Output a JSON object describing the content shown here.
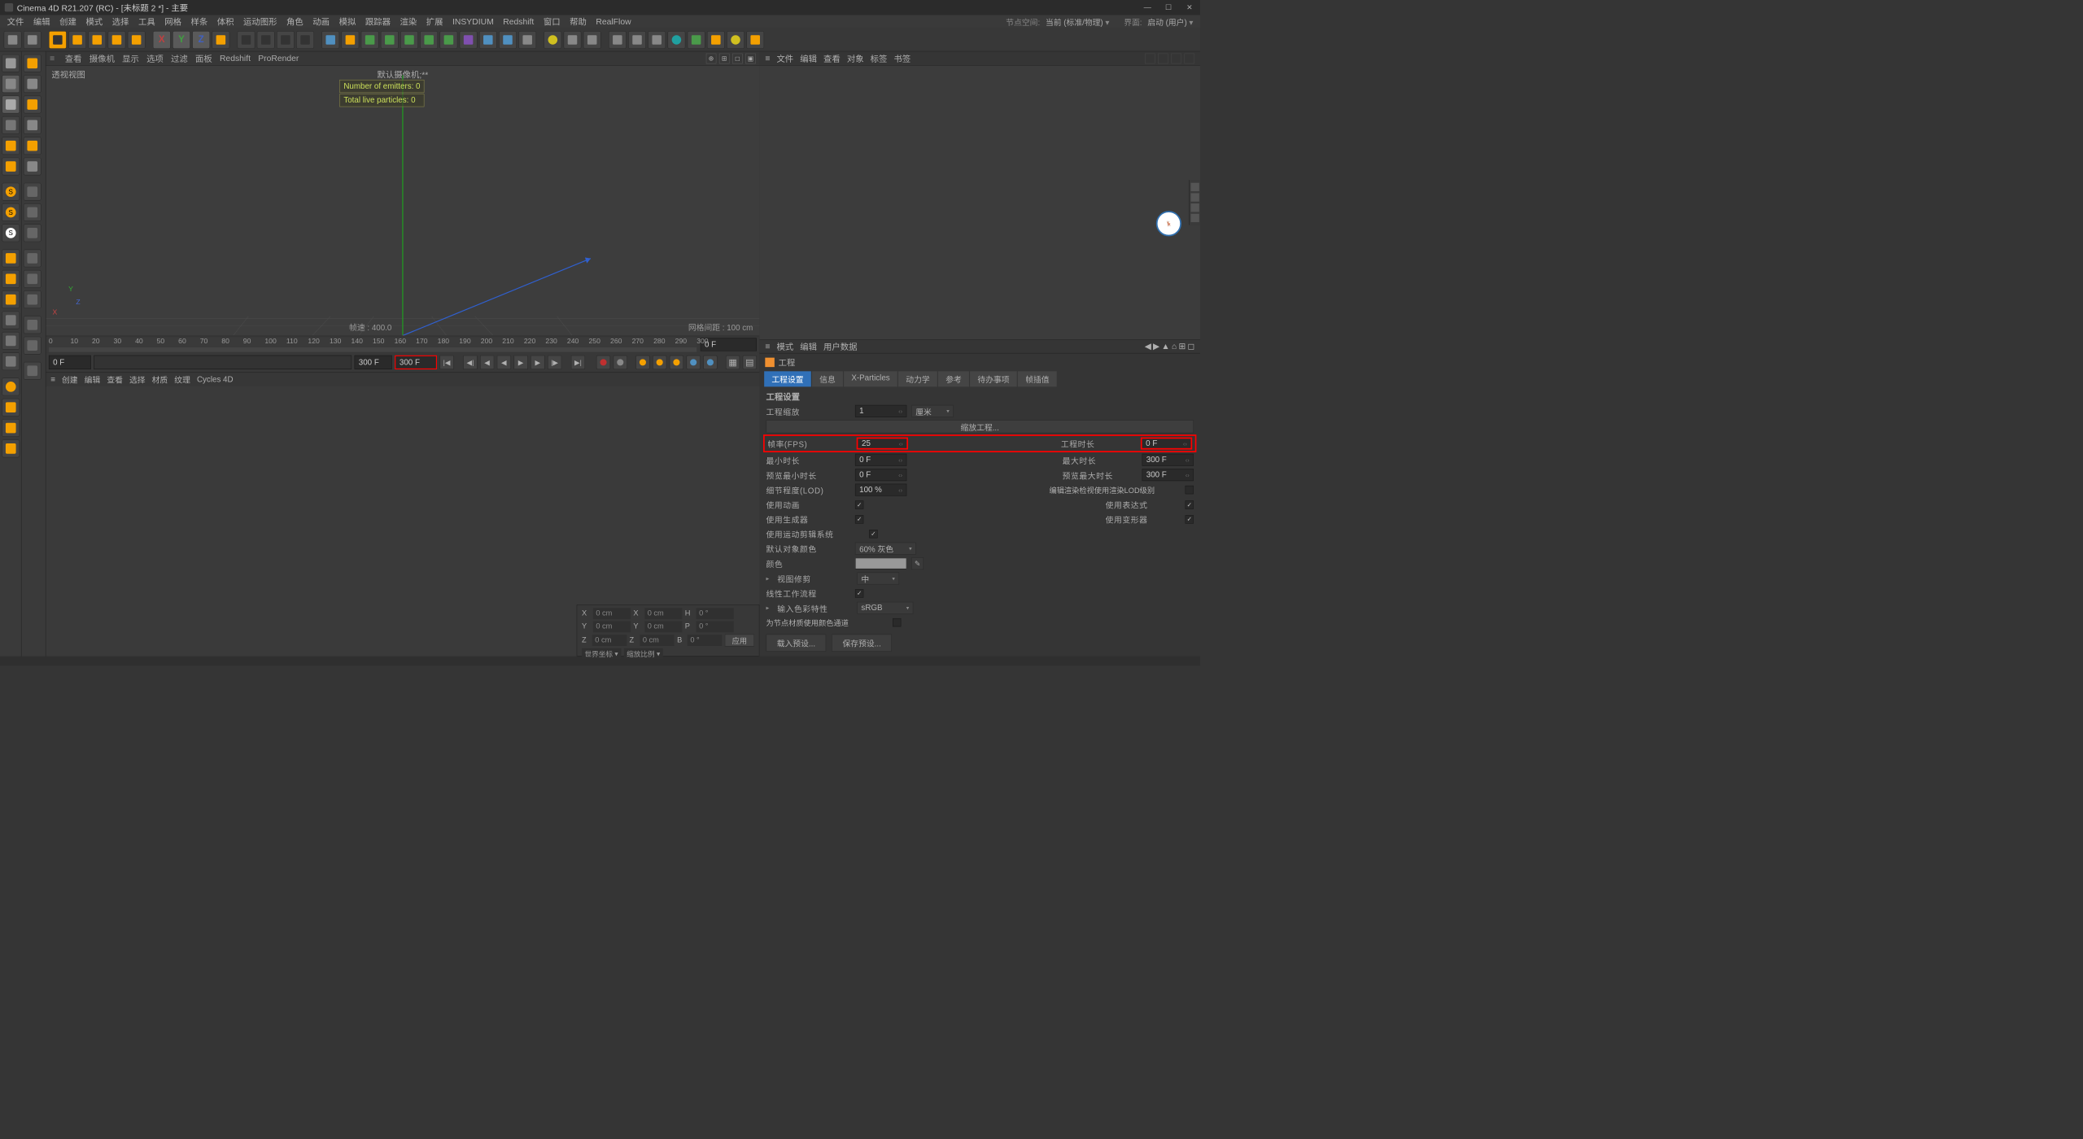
{
  "title": "Cinema 4D R21.207 (RC) - [未标题 2 *] - 主要",
  "menu": [
    "文件",
    "编辑",
    "创建",
    "模式",
    "选择",
    "工具",
    "网格",
    "样条",
    "体积",
    "运动图形",
    "角色",
    "动画",
    "模拟",
    "跟踪器",
    "渲染",
    "扩展",
    "INSYDIUM",
    "Redshift",
    "窗口",
    "帮助",
    "RealFlow"
  ],
  "menu_right": {
    "nodespace": "节点空间:",
    "nodespace_val": "当前 (标准/物理)",
    "layout": "界面:",
    "layout_val": "启动 (用户)"
  },
  "vp": {
    "tabs": [
      "查看",
      "摄像机",
      "显示",
      "选项",
      "过滤",
      "面板",
      "Redshift",
      "ProRender"
    ],
    "title": "透视视图",
    "cam": "默认摄像机;**",
    "hud1": "Number of emitters: 0",
    "hud2": "Total live particles: 0",
    "fps_label": "帧速 : 400.0",
    "grid_label": "网格间距 : 100 cm",
    "axis": {
      "x": "X",
      "y": "Y",
      "z": "Z"
    }
  },
  "tl": {
    "ticks": [
      "0",
      "10",
      "20",
      "30",
      "40",
      "50",
      "60",
      "70",
      "80",
      "90",
      "100",
      "110",
      "120",
      "130",
      "140",
      "150",
      "160",
      "170",
      "180",
      "190",
      "200",
      "210",
      "220",
      "230",
      "240",
      "250",
      "260",
      "270",
      "280",
      "290",
      "300"
    ],
    "end": "0 F",
    "cur": "0 F",
    "from": "0 F",
    "to": "300 F",
    "to2": "300 F"
  },
  "mat_tabs": [
    "创建",
    "编辑",
    "查看",
    "选择",
    "材质",
    "纹理",
    "Cycles 4D"
  ],
  "coord": {
    "rows": [
      [
        "X",
        "0 cm",
        "X",
        "0 cm",
        "H",
        "0 °"
      ],
      [
        "Y",
        "0 cm",
        "Y",
        "0 cm",
        "P",
        "0 °"
      ],
      [
        "Z",
        "0 cm",
        "Z",
        "0 cm",
        "B",
        "0 °"
      ]
    ],
    "sel1": "世界坐标",
    "sel2": "缩放比例",
    "apply": "应用"
  },
  "obj_menu": [
    "文件",
    "编辑",
    "查看",
    "对象",
    "标签",
    "书签"
  ],
  "attr_menu": [
    "模式",
    "编辑",
    "用户数据"
  ],
  "attr_title": "工程",
  "attr_tabs": [
    "工程设置",
    "信息",
    "X-Particles",
    "动力学",
    "参考",
    "待办事项",
    "帧插值"
  ],
  "section": "工程设置",
  "p": {
    "scale": "工程缩放",
    "scale_v": "1",
    "scale_u": "厘米",
    "scalebtn": "缩放工程...",
    "fps": "帧率(FPS)",
    "fps_v": "25",
    "dur": "工程时长",
    "dur_v": "0 F",
    "min": "最小时长",
    "min_v": "0 F",
    "max": "最大时长",
    "max_v": "300 F",
    "pmin": "预览最小时长",
    "pmin_v": "0 F",
    "pmax": "预览最大时长",
    "pmax_v": "300 F",
    "lod": "细节程度(LOD)",
    "lod_v": "100 %",
    "lod_chk": "编辑渲染检视使用渲染LOD级别",
    "anim": "使用动画",
    "expr": "使用表达式",
    "gen": "使用生成器",
    "def": "使用变形器",
    "mot": "使用运动剪辑系统",
    "defcol": "默认对象颜色",
    "defcol_v": "60% 灰色",
    "col": "颜色",
    "clip": "视图修剪",
    "clip_v": "中",
    "linear": "线性工作流程",
    "srgb": "输入色彩特性",
    "srgb_v": "sRGB",
    "nodemat": "为节点材质使用颜色通道",
    "load": "载入预设...",
    "save": "保存预设..."
  }
}
